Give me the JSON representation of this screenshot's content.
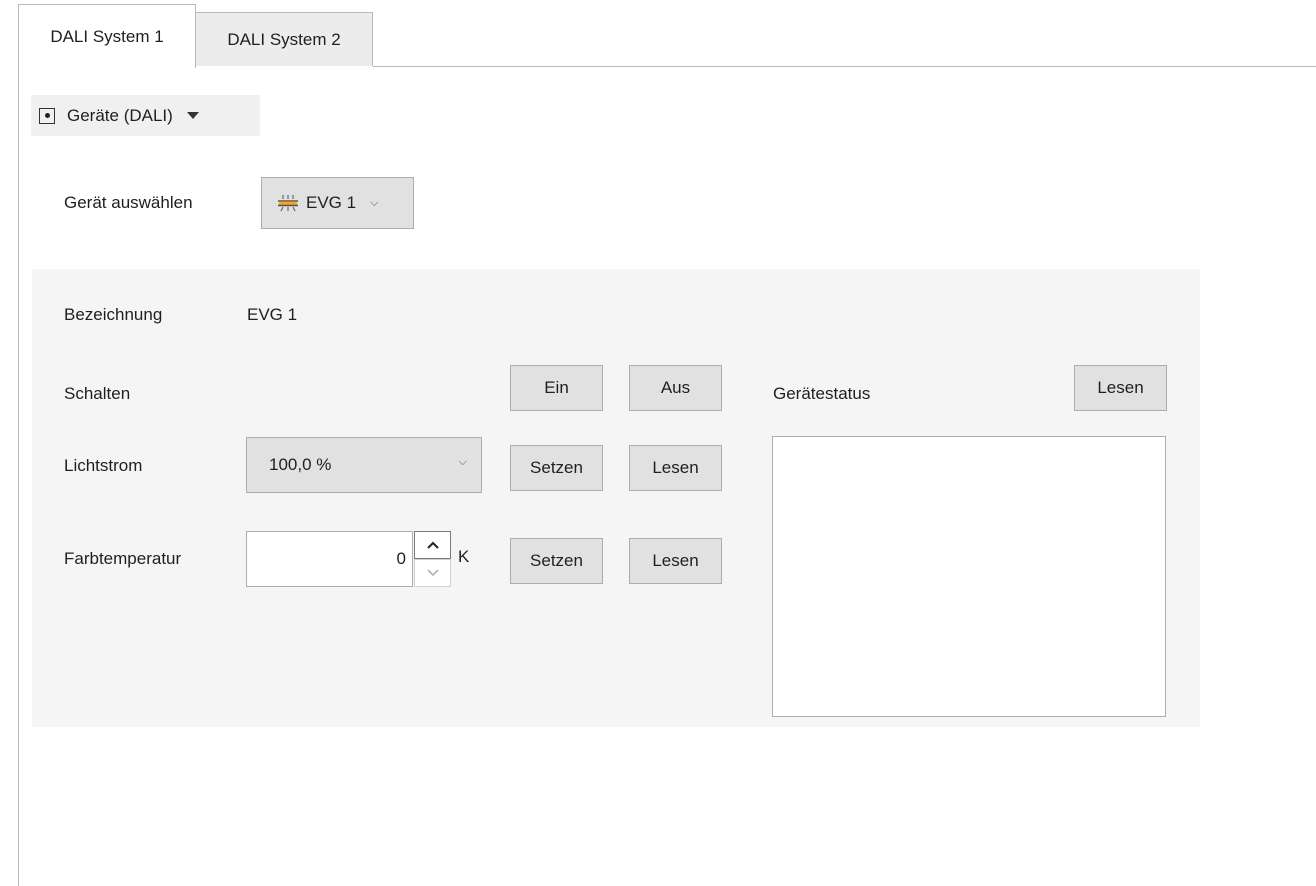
{
  "tabs": [
    {
      "label": "DALI System 1",
      "active": true
    },
    {
      "label": "DALI System 2",
      "active": false
    }
  ],
  "view_selector": {
    "label": "Geräte (DALI)"
  },
  "device_select": {
    "label": "Gerät auswählen",
    "value": "EVG 1",
    "icon": "ballast-icon"
  },
  "panel": {
    "designation": {
      "label": "Bezeichnung",
      "value": "EVG 1"
    },
    "switch": {
      "label": "Schalten",
      "on_button": "Ein",
      "off_button": "Aus"
    },
    "luminous_flux": {
      "label": "Lichtstrom",
      "value": "100,0 %",
      "set_button": "Setzen",
      "read_button": "Lesen"
    },
    "color_temp": {
      "label": "Farbtemperatur",
      "value": "0",
      "unit": "K",
      "set_button": "Setzen",
      "read_button": "Lesen"
    },
    "device_status": {
      "label": "Gerätestatus",
      "read_button": "Lesen"
    }
  },
  "colors": {
    "panel_bg": "#f5f5f5",
    "button_bg": "#e1e1e1",
    "border": "#adadad"
  }
}
